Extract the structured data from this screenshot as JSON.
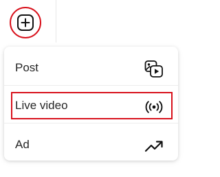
{
  "create_button": {
    "icon": "plus-square-icon",
    "highlight_color": "#d8101b"
  },
  "menu": {
    "items": [
      {
        "label": "Post",
        "icon": "photo-video-icon"
      },
      {
        "label": "Live video",
        "icon": "live-broadcast-icon",
        "highlighted": true
      },
      {
        "label": "Ad",
        "icon": "trending-up-icon"
      }
    ]
  }
}
